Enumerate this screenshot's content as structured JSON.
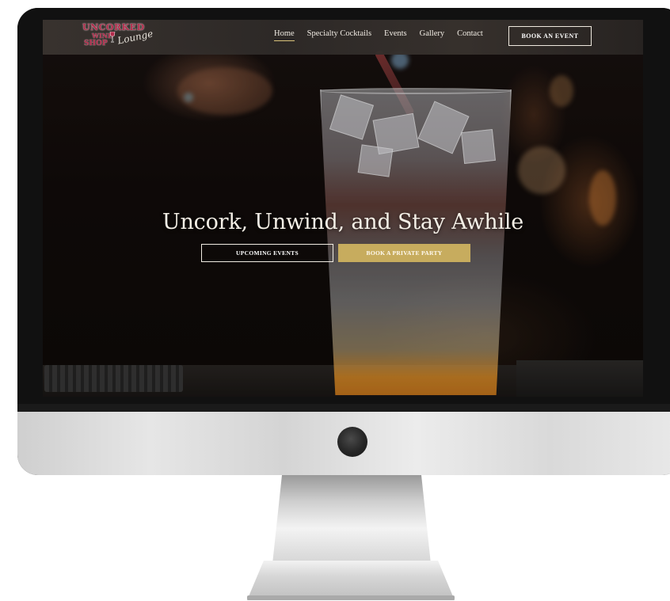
{
  "site": {
    "logo": {
      "line1": "UNCORKED",
      "line2": "WINE",
      "line3": "SHOP",
      "script": "Lounge"
    },
    "nav": {
      "links": [
        "Home",
        "Specialty Cocktails",
        "Events",
        "Gallery",
        "Contact"
      ],
      "active": "Home",
      "cta": "BOOK AN EVENT"
    },
    "hero": {
      "title": "Uncork, Unwind, and Stay Awhile",
      "buttons": {
        "events": "UPCOMING EVENTS",
        "party": "BOOK A PRIVATE PARTY"
      }
    }
  },
  "colors": {
    "accent_gold": "#c7ac5e",
    "brand_wine": "#b12a4a",
    "nav_text": "#f1ece4"
  },
  "icons": {
    "logo_glass": "wine-glass-icon"
  }
}
